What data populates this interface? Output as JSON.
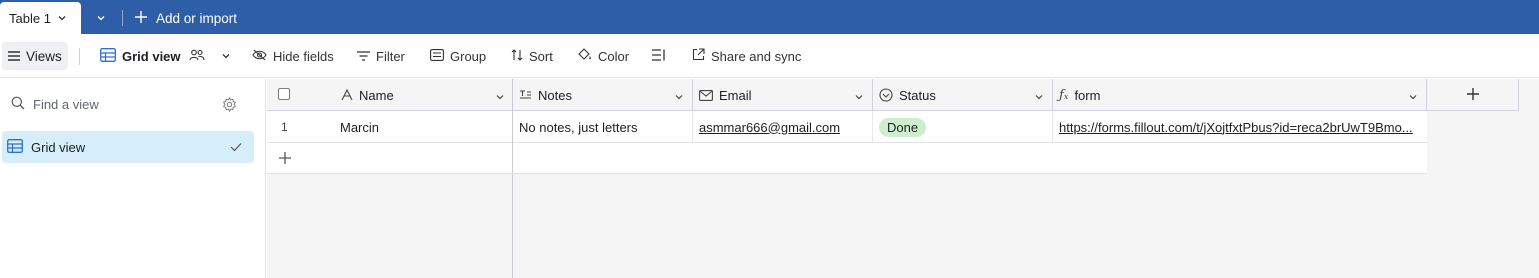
{
  "tabs": {
    "active_label": "Table 1",
    "add_import_label": "Add or import"
  },
  "toolbar": {
    "views_label": "Views",
    "grid_view_label": "Grid view",
    "hide_fields_label": "Hide fields",
    "filter_label": "Filter",
    "group_label": "Group",
    "sort_label": "Sort",
    "color_label": "Color",
    "share_label": "Share and sync"
  },
  "sidebar": {
    "search_placeholder": "Find a view",
    "items": [
      {
        "label": "Grid view",
        "selected": true
      }
    ]
  },
  "grid": {
    "columns": [
      {
        "label": "Name",
        "icon": "text-a-icon"
      },
      {
        "label": "Notes",
        "icon": "long-text-icon"
      },
      {
        "label": "Email",
        "icon": "mail-icon"
      },
      {
        "label": "Status",
        "icon": "status-circle-check-icon"
      },
      {
        "label": "form",
        "icon": "formula-fx-icon"
      }
    ],
    "rows": [
      {
        "number": "1",
        "name": "Marcin",
        "notes": "No notes, just letters",
        "email": "asmmar666@gmail.com",
        "status": "Done",
        "form": "https://forms.fillout.com/t/jXojtfxtPbus?id=reca2brUwT9Bmo..."
      }
    ]
  },
  "colors": {
    "topbar": "#2d5ea7",
    "selected_view_bg": "#d6eef9",
    "status_done_bg": "#cfeecf"
  }
}
